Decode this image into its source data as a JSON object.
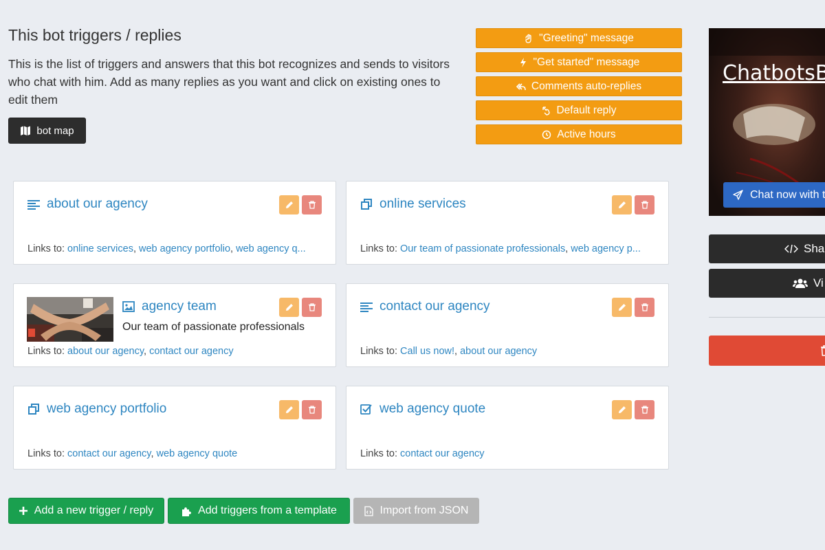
{
  "header": {
    "title": "This bot triggers / replies",
    "description": "This is the list of triggers and answers that this bot recognizes and sends to visitors who chat with him. Add as many replies as you want and click on existing ones to edit them",
    "bot_map_label": "bot map"
  },
  "special_buttons": [
    {
      "label": "\"Greeting\" message",
      "icon": "wave-hand-icon"
    },
    {
      "label": "\"Get started\" message",
      "icon": "bolt-icon"
    },
    {
      "label": "Comments auto-replies",
      "icon": "reply-all-icon"
    },
    {
      "label": "Default reply",
      "icon": "hand-pointer-icon"
    },
    {
      "label": "Active hours",
      "icon": "clock-icon"
    }
  ],
  "links_prefix": "Links to:",
  "triggers": [
    {
      "title": "about our agency",
      "icon": "align-left-icon",
      "links": [
        "online services",
        "web agency portfolio",
        "web agency q..."
      ],
      "link_seps": [
        ", ",
        ", "
      ]
    },
    {
      "title": "online services",
      "icon": "clone-icon",
      "links": [
        "Our team of passionate professionals",
        "web agency p..."
      ],
      "link_seps": [
        ", "
      ]
    },
    {
      "title": "agency team",
      "icon": "image-icon",
      "subtitle": "Our team of passionate professionals",
      "links": [
        "about our agency",
        "contact our agency"
      ],
      "link_seps": [
        ", "
      ]
    },
    {
      "title": "contact our agency",
      "icon": "align-left-icon",
      "links": [
        "Call us now!",
        "about our agency"
      ],
      "link_seps": [
        ", "
      ]
    },
    {
      "title": "web agency portfolio",
      "icon": "clone-icon",
      "links": [
        "contact our agency",
        "web agency quote"
      ],
      "link_seps": [
        ", "
      ]
    },
    {
      "title": "web agency quote",
      "icon": "check-square-icon",
      "links": [
        "contact our agency"
      ],
      "link_seps": []
    }
  ],
  "bottom_buttons": {
    "add_trigger": "Add a new trigger / reply",
    "add_template": "Add triggers from a template",
    "import_json": "Import from JSON"
  },
  "sidebar": {
    "preview_title": "ChatbotsB",
    "chat_now": "Chat now with t",
    "share": "Sha",
    "view": "Vi"
  },
  "colors": {
    "orange": "#f39c12",
    "link_blue": "#2e86c1",
    "green": "#1aa04f",
    "red": "#e04a35"
  }
}
